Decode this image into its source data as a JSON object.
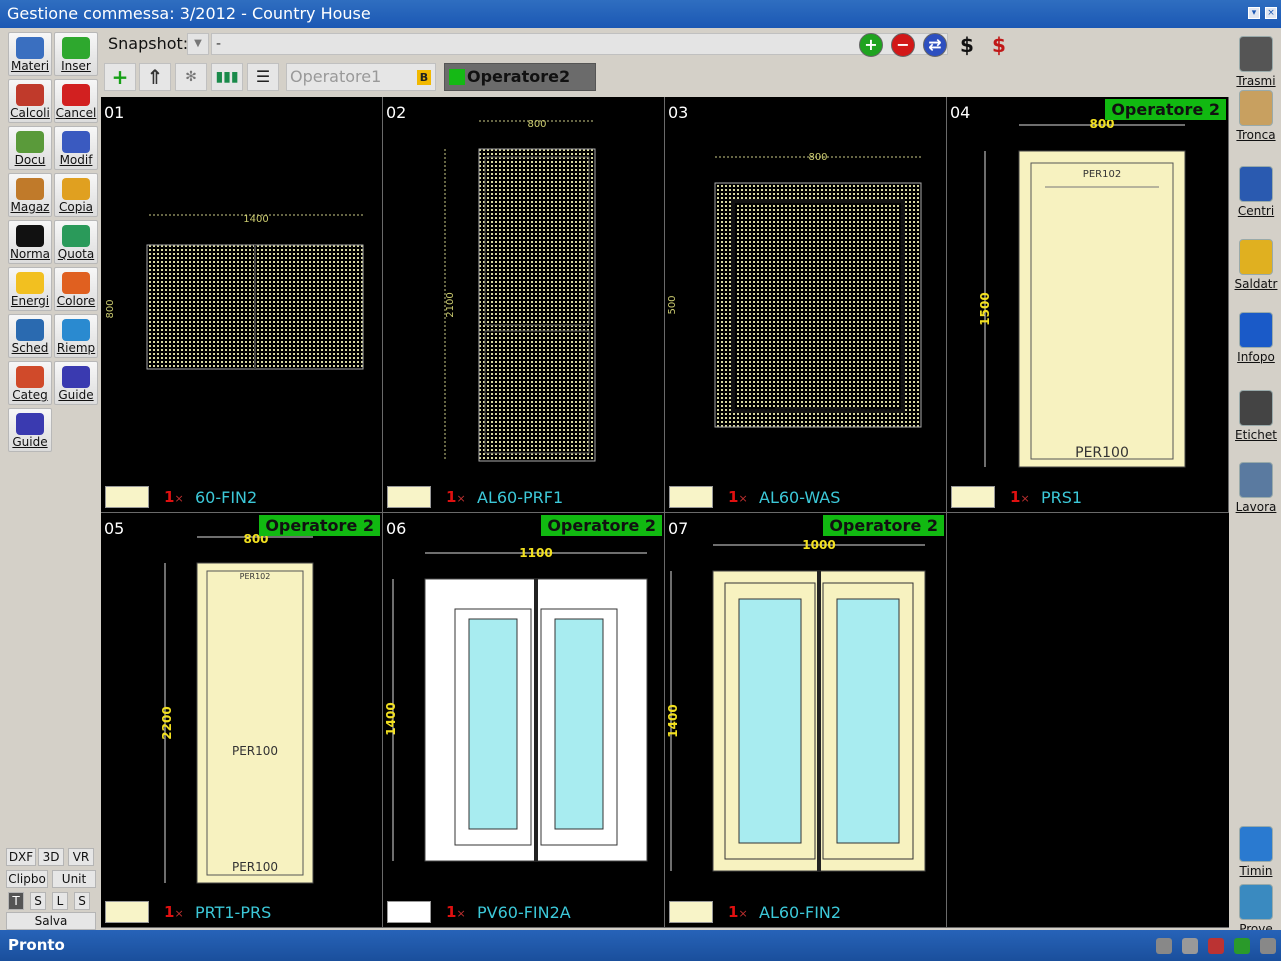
{
  "window": {
    "title": "Gestione commessa: 3/2012 - Country House"
  },
  "left_toolbar": [
    {
      "label": "Materi",
      "color": "#3a6fc0"
    },
    {
      "label": "Inser",
      "color": "#2ea82e"
    },
    {
      "label": "Calcoli",
      "color": "#c03a2b"
    },
    {
      "label": "Cancel",
      "color": "#d22020"
    },
    {
      "label": "Docu",
      "color": "#5a9a3a"
    },
    {
      "label": "Modif",
      "color": "#3a5ac0"
    },
    {
      "label": "Magaz",
      "color": "#c07a2a"
    },
    {
      "label": "Copia",
      "color": "#e0a020"
    },
    {
      "label": "Norma",
      "color": "#111111"
    },
    {
      "label": "Quota",
      "color": "#2a9a5a"
    },
    {
      "label": "Energi",
      "color": "#f2c020"
    },
    {
      "label": "Colore",
      "color": "#e06020"
    },
    {
      "label": "Sched",
      "color": "#2a6ab0"
    },
    {
      "label": "Riemp",
      "color": "#2a8ad0"
    },
    {
      "label": "Categ",
      "color": "#d04a2a"
    },
    {
      "label": "Guide",
      "color": "#3a3ab0"
    },
    {
      "label": "Guide",
      "color": "#3a3ab0"
    }
  ],
  "left_bottom": {
    "dxf": "DXF",
    "d3": "3D",
    "vr": "VR",
    "clipbo": "Clipbo",
    "unit": "Unit",
    "t": "T",
    "s": "S",
    "l": "L",
    "s2": "S",
    "salva": "Salva"
  },
  "right_toolbar": [
    {
      "label": "Trasmi",
      "color": "#555555"
    },
    {
      "label": "Tronca",
      "color": "#c8a060"
    },
    {
      "label": "Centri",
      "color": "#2a5ab0"
    },
    {
      "label": "Saldatr",
      "color": "#e0b020"
    },
    {
      "label": "Infopo",
      "color": "#1a5ac8"
    },
    {
      "label": "Etichet",
      "color": "#444444"
    },
    {
      "label": "Lavora",
      "color": "#5a7aa0"
    },
    {
      "label": "Timin",
      "color": "#2a7ad0"
    },
    {
      "label": "Prove",
      "color": "#3a8ac0"
    }
  ],
  "topbar": {
    "snapshot_label": "Snapshot:",
    "snapshot_value": "-",
    "operator1": "Operatore1",
    "operator1_badge": "B",
    "operator2": "Operatore2"
  },
  "cells": [
    {
      "num": "01",
      "code": "60-FIN2",
      "qty": "1",
      "swatch": "#f8f4c8",
      "operator": ""
    },
    {
      "num": "02",
      "code": "AL60-PRF1",
      "qty": "1",
      "swatch": "#f8f4c8",
      "operator": ""
    },
    {
      "num": "03",
      "code": "AL60-WAS",
      "qty": "1",
      "swatch": "#f8f4c8",
      "operator": ""
    },
    {
      "num": "04",
      "code": "PRS1",
      "qty": "1",
      "swatch": "#f8f4c8",
      "operator": "Operatore 2"
    },
    {
      "num": "05",
      "code": "PRT1-PRS",
      "qty": "1",
      "swatch": "#f8f4c8",
      "operator": "Operatore 2"
    },
    {
      "num": "06",
      "code": "PV60-FIN2A",
      "qty": "1",
      "swatch": "#ffffff",
      "operator": "Operatore 2"
    },
    {
      "num": "07",
      "code": "AL60-FIN2",
      "qty": "1",
      "swatch": "#f8f4c8",
      "operator": "Operatore 2"
    }
  ],
  "drawings": {
    "d01": {
      "w": "1400",
      "h": "800"
    },
    "d02": {
      "w": "800",
      "h": "2100"
    },
    "d03": {
      "w": "800",
      "h": "500"
    },
    "d04": {
      "w": "800",
      "h": "1500",
      "label_top": "PER102",
      "label_bottom": "PER100",
      "side": "PER102"
    },
    "d05": {
      "w": "800",
      "h": "2200",
      "label_top": "PER102",
      "label_mid": "PER100",
      "label_bottom": "PER100"
    },
    "d06": {
      "w": "1100",
      "h": "1400"
    },
    "d07": {
      "w": "1000",
      "h": "1400"
    }
  },
  "times_sign": "×",
  "status": {
    "text": "Pronto"
  }
}
